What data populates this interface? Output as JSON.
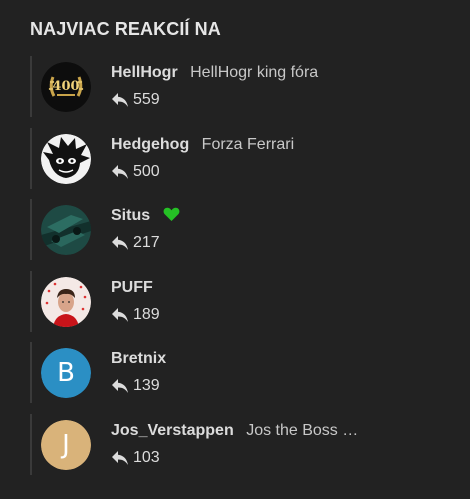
{
  "widget": {
    "title": "NAJVIAC REAKCIÍ NA"
  },
  "users": [
    {
      "username": "HellHogr",
      "title": "HellHogr king fóra",
      "count": "559",
      "avatar": "400-laurel-avatar"
    },
    {
      "username": "Hedgehog",
      "title": "Forza Ferrari",
      "count": "500",
      "avatar": "hedgehog-avatar"
    },
    {
      "username": "Situs",
      "title": "",
      "count": "217",
      "avatar": "car-avatar",
      "badge": "green-heart-icon"
    },
    {
      "username": "PUFF",
      "title": "",
      "count": "189",
      "avatar": "driver-photo-avatar"
    },
    {
      "username": "Bretnix",
      "title": "",
      "count": "139",
      "avatar_letter": "B",
      "avatar_color": "#2b8fc4"
    },
    {
      "username": "Jos_Verstappen",
      "title": "Jos the Boss …",
      "count": "103",
      "avatar_letter": "J",
      "avatar_color": "#d9b37a"
    }
  ],
  "colors": {
    "background": "#222222",
    "heart": "#25c125"
  }
}
